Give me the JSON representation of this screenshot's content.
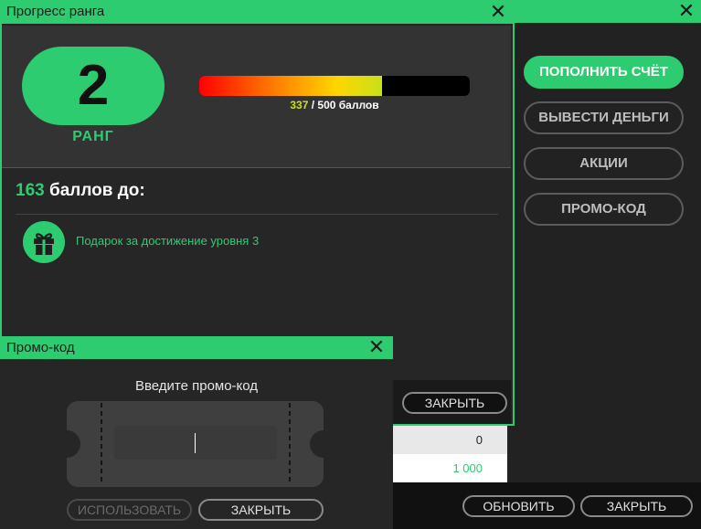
{
  "account": {
    "buttons": [
      {
        "label": "ПОПОЛНИТЬ СЧЁТ"
      },
      {
        "label": "ВЫВЕСТИ ДЕНЬГИ"
      },
      {
        "label": "АКЦИИ"
      },
      {
        "label": "ПРОМО-КОД"
      }
    ],
    "table": {
      "row1": "0",
      "row2": "1 000"
    },
    "footer": {
      "refresh_label": "ОБНОВИТЬ",
      "close_label": "ЗАКРЫТЬ"
    }
  },
  "rank": {
    "title": "Прогресс ранга",
    "rank_number": "2",
    "rank_label": "РАНГ",
    "progress": {
      "current": 337,
      "max": 500,
      "current_text": "337",
      "max_text": "/ 500 баллов"
    },
    "points_needed": "163",
    "points_text": " баллов до:",
    "reward_text": "Подарок за достижение уровня 3",
    "close_label": "ЗАКРЫТЬ"
  },
  "promo": {
    "title": "Промо-код",
    "prompt": "Введите промо-код",
    "input_value": "",
    "use_label": "ИСПОЛЬЗОВАТЬ",
    "close_label": "ЗАКРЫТЬ"
  },
  "colors": {
    "accent": "#2ecc71",
    "bar_end": "#c9e01a"
  },
  "icons": [
    "close-icon",
    "gift-icon"
  ]
}
